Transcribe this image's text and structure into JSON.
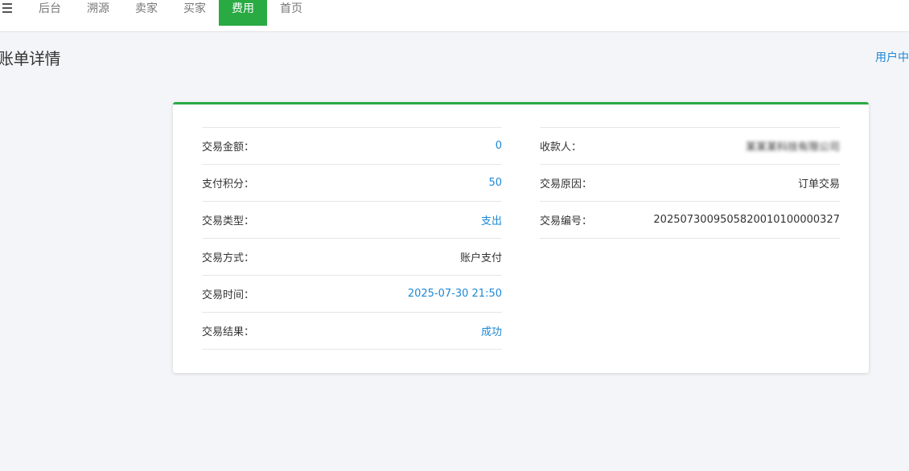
{
  "nav": {
    "items": [
      {
        "label": "后台",
        "active": false
      },
      {
        "label": "溯源",
        "active": false
      },
      {
        "label": "卖家",
        "active": false
      },
      {
        "label": "买家",
        "active": false
      },
      {
        "label": "费用",
        "active": true
      },
      {
        "label": "首页",
        "active": false
      }
    ]
  },
  "page": {
    "title": "账单详情",
    "user_link": "用户中心"
  },
  "details": {
    "left": [
      {
        "label": "交易金额：",
        "value": "0"
      },
      {
        "label": "支付积分：",
        "value": "50"
      },
      {
        "label": "交易类型：",
        "value": "支出"
      },
      {
        "label": "交易方式：",
        "value": "账户支付"
      },
      {
        "label": "交易时间：",
        "value": "2025-07-30 21:50"
      },
      {
        "label": "交易结果：",
        "value": "成功"
      }
    ],
    "right": [
      {
        "label": "收款人：",
        "value": "某某某科技有限公司"
      },
      {
        "label": "交易原因：",
        "value": "订单交易"
      },
      {
        "label": "交易编号：",
        "value": "20250730095058200101000003​27"
      }
    ]
  },
  "colors": {
    "accent": "#2aaa43",
    "link": "#1e88d6"
  }
}
